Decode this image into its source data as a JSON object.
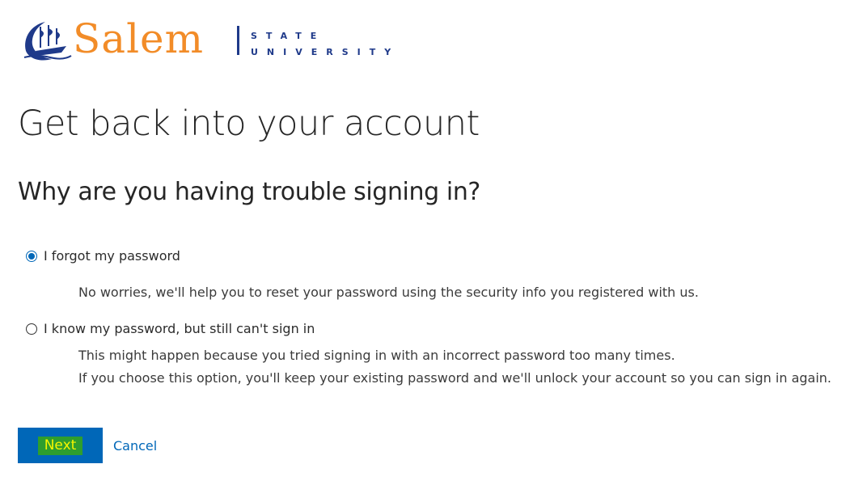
{
  "logo": {
    "wordmark": "Salem",
    "state": "STATE",
    "university": "UNIVERSITY",
    "icon": "ship-icon",
    "colors": {
      "wordmark": "#f28c28",
      "mark": "#1f3a8a"
    }
  },
  "header": {
    "title": "Get back into your account",
    "subtitle": "Why are you having trouble signing in?"
  },
  "options": [
    {
      "label": "I forgot my password",
      "selected": true,
      "description": [
        "No worries, we'll help you to reset your password using the security info you registered with us."
      ]
    },
    {
      "label": "I know my password, but still can't sign in",
      "selected": false,
      "description": [
        "This might happen because you tried signing in with an incorrect password too many times.",
        "If you choose this option, you'll keep your existing password and we'll unlock your account so you can sign in again."
      ]
    }
  ],
  "actions": {
    "next_label": "Next",
    "cancel_label": "Cancel"
  },
  "colors": {
    "accent": "#0067b8",
    "next_highlight_bg": "#2e9e2e",
    "next_highlight_text": "#f5f500"
  }
}
